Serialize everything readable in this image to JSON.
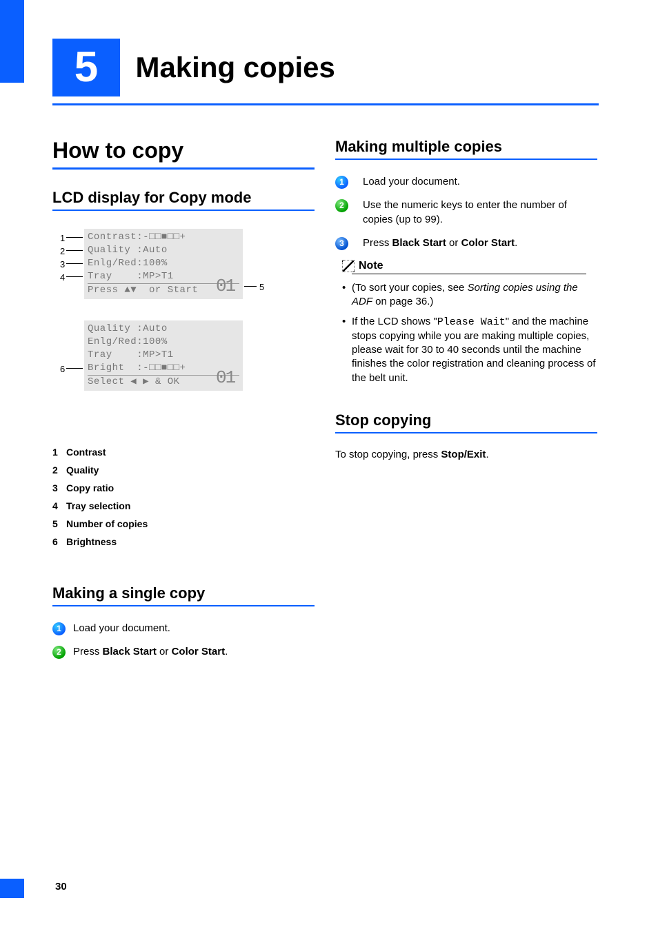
{
  "chapter": {
    "number": "5",
    "title": "Making copies"
  },
  "page_number": "30",
  "left": {
    "h1": "How to copy",
    "sec1": {
      "h2": "LCD display for Copy mode",
      "lcd1": {
        "row1": "Contrast:-□□■□□+",
        "row2": "Quality :Auto",
        "row3": "Enlg/Red:100%",
        "row4": "Tray    :MP>T1",
        "footer": "Press ▲▼  or Start",
        "counter": "01"
      },
      "lcd2": {
        "row1": "Quality :Auto",
        "row2": "Enlg/Red:100%",
        "row3": "Tray    :MP>T1",
        "row4": "Bright  :-□□■□□+",
        "footer": "Select ◀ ▶ & OK",
        "counter": "01"
      },
      "labels": {
        "l1": "1",
        "l2": "2",
        "l3": "3",
        "l4": "4",
        "l5": "5",
        "l6": "6"
      },
      "legend": [
        {
          "n": "1",
          "t": "Contrast"
        },
        {
          "n": "2",
          "t": "Quality"
        },
        {
          "n": "3",
          "t": "Copy ratio"
        },
        {
          "n": "4",
          "t": "Tray selection"
        },
        {
          "n": "5",
          "t": "Number of copies"
        },
        {
          "n": "6",
          "t": "Brightness"
        }
      ]
    },
    "sec2": {
      "h2": "Making a single copy",
      "step1": "Load your document.",
      "step2_pre": "Press ",
      "step2_b1": "Black Start",
      "step2_or": " or ",
      "step2_b2": "Color Start",
      "step2_post": "."
    }
  },
  "right": {
    "sec1": {
      "h2": "Making multiple copies",
      "step1": "Load your document.",
      "step2": "Use the numeric keys to enter the number of copies (up to 99).",
      "step3_pre": "Press ",
      "step3_b1": "Black Start",
      "step3_or": " or ",
      "step3_b2": "Color Start",
      "step3_post": ".",
      "note_label": "Note",
      "note_li1_pre": "(To sort your copies, see ",
      "note_li1_italic": "Sorting copies using the ADF",
      "note_li1_post": " on page 36.)",
      "note_li2_pre": "If the LCD shows \"",
      "note_li2_mono": "Please Wait",
      "note_li2_post": "\" and the machine stops copying while you are making multiple copies, please wait for 30 to 40 seconds until the machine finishes the color registration and cleaning process of the belt unit."
    },
    "sec2": {
      "h2": "Stop copying",
      "body_pre": "To stop copying, press ",
      "body_b": "Stop/Exit",
      "body_post": "."
    }
  }
}
